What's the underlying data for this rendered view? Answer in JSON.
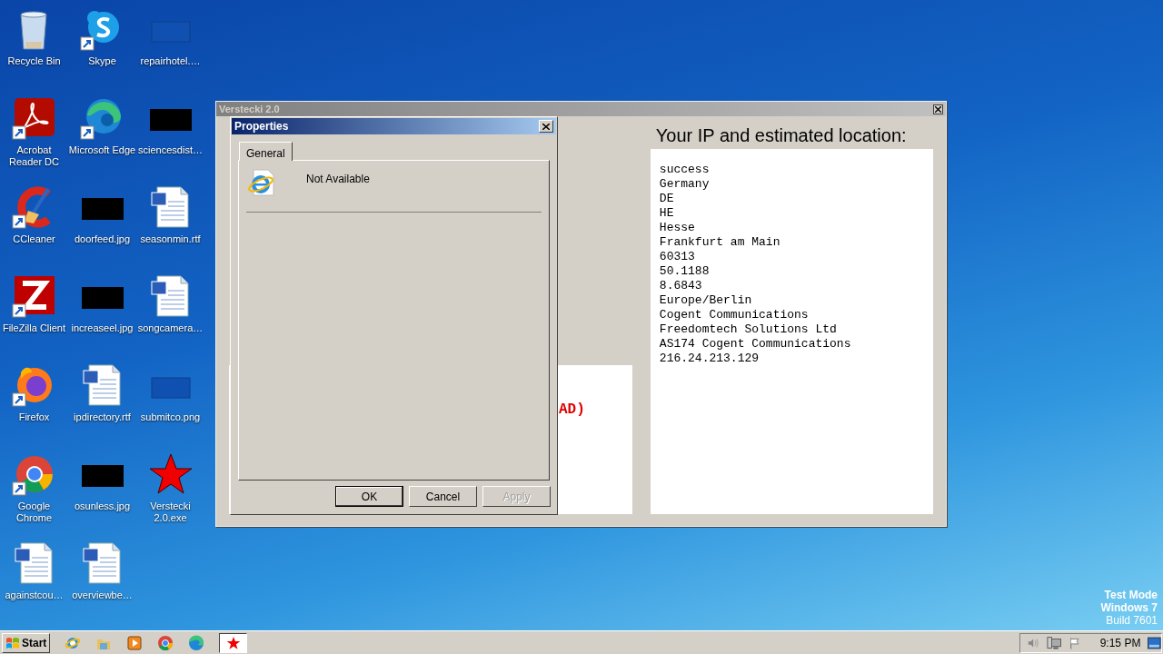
{
  "desktop": {
    "icons": [
      {
        "label": "Recycle Bin",
        "kind": "recycle_bin",
        "shortcut": false
      },
      {
        "label": "Skype",
        "kind": "skype",
        "shortcut": true
      },
      {
        "label": "repairhotel.…",
        "kind": "blank_image",
        "shortcut": false
      },
      {
        "label": "Acrobat Reader DC",
        "kind": "acrobat",
        "shortcut": true
      },
      {
        "label": "Microsoft Edge",
        "kind": "edge",
        "shortcut": true
      },
      {
        "label": "sciencesdist…",
        "kind": "dark_image",
        "shortcut": false
      },
      {
        "label": "CCleaner",
        "kind": "ccleaner",
        "shortcut": true
      },
      {
        "label": "doorfeed.jpg",
        "kind": "dark_image",
        "shortcut": false
      },
      {
        "label": "seasonmin.rtf",
        "kind": "word_document",
        "shortcut": false
      },
      {
        "label": "FileZilla Client",
        "kind": "filezilla",
        "shortcut": true
      },
      {
        "label": "increaseel.jpg",
        "kind": "dark_image",
        "shortcut": false
      },
      {
        "label": "songcamera…",
        "kind": "word_document",
        "shortcut": false
      },
      {
        "label": "Firefox",
        "kind": "firefox",
        "shortcut": true
      },
      {
        "label": "ipdirectory.rtf",
        "kind": "word_document",
        "shortcut": false
      },
      {
        "label": "submitco.png",
        "kind": "blank_image",
        "shortcut": false
      },
      {
        "label": "Google Chrome",
        "kind": "chrome",
        "shortcut": true
      },
      {
        "label": "osunless.jpg",
        "kind": "dark_image",
        "shortcut": false
      },
      {
        "label": "Verstecki 2.0.exe",
        "kind": "red_star",
        "shortcut": false
      },
      {
        "label": "againstcou…",
        "kind": "word_document",
        "shortcut": false
      },
      {
        "label": "overviewbe…",
        "kind": "word_document",
        "shortcut": false
      }
    ]
  },
  "main_window": {
    "title": "Verstecki 2.0",
    "active": false,
    "partial_status": "AD)",
    "location_heading": "Your IP and estimated location:",
    "location_lines": [
      "success",
      "Germany",
      "DE",
      "HE",
      "Hesse",
      "Frankfurt am Main",
      "60313",
      "50.1188",
      "8.6843",
      "Europe/Berlin",
      "Cogent Communications",
      "Freedomtech Solutions Ltd",
      "AS174 Cogent Communications",
      "216.24.213.129"
    ]
  },
  "dialog": {
    "title": "Properties",
    "active": true,
    "tabs": [
      {
        "label": "General",
        "selected": true
      }
    ],
    "item_name": "Not Available",
    "buttons": [
      {
        "label": "OK",
        "default": true,
        "disabled": false
      },
      {
        "label": "Cancel",
        "default": false,
        "disabled": false
      },
      {
        "label": "Apply",
        "default": false,
        "disabled": true
      }
    ]
  },
  "system_notice": [
    "Test Mode",
    "Windows 7",
    "Build 7601"
  ],
  "taskbar": {
    "start_label": "Start",
    "quick_launch": [
      {
        "kind": "ie"
      },
      {
        "kind": "explorer"
      },
      {
        "kind": "media_player"
      },
      {
        "kind": "chrome"
      },
      {
        "kind": "edge"
      }
    ],
    "tasks": [
      {
        "kind": "red_star",
        "selected": true
      }
    ],
    "clock": "9:15 PM"
  }
}
